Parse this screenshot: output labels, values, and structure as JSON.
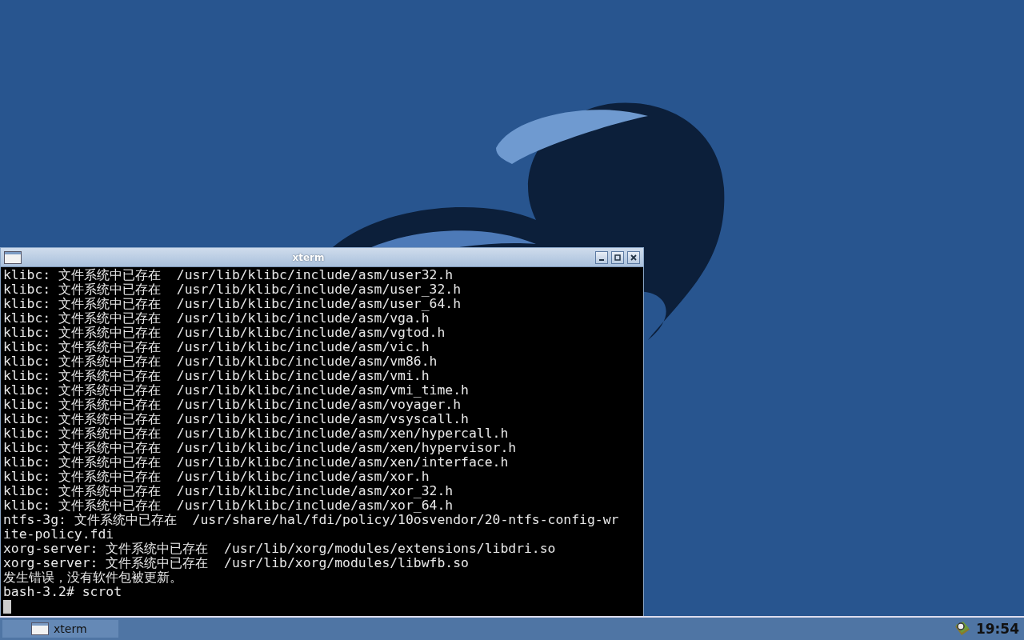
{
  "window": {
    "title": "xterm",
    "lines": [
      "klibc: 文件系统中已存在  /usr/lib/klibc/include/asm/user32.h",
      "klibc: 文件系统中已存在  /usr/lib/klibc/include/asm/user_32.h",
      "klibc: 文件系统中已存在  /usr/lib/klibc/include/asm/user_64.h",
      "klibc: 文件系统中已存在  /usr/lib/klibc/include/asm/vga.h",
      "klibc: 文件系统中已存在  /usr/lib/klibc/include/asm/vgtod.h",
      "klibc: 文件系统中已存在  /usr/lib/klibc/include/asm/vic.h",
      "klibc: 文件系统中已存在  /usr/lib/klibc/include/asm/vm86.h",
      "klibc: 文件系统中已存在  /usr/lib/klibc/include/asm/vmi.h",
      "klibc: 文件系统中已存在  /usr/lib/klibc/include/asm/vmi_time.h",
      "klibc: 文件系统中已存在  /usr/lib/klibc/include/asm/voyager.h",
      "klibc: 文件系统中已存在  /usr/lib/klibc/include/asm/vsyscall.h",
      "klibc: 文件系统中已存在  /usr/lib/klibc/include/asm/xen/hypercall.h",
      "klibc: 文件系统中已存在  /usr/lib/klibc/include/asm/xen/hypervisor.h",
      "klibc: 文件系统中已存在  /usr/lib/klibc/include/asm/xen/interface.h",
      "klibc: 文件系统中已存在  /usr/lib/klibc/include/asm/xor.h",
      "klibc: 文件系统中已存在  /usr/lib/klibc/include/asm/xor_32.h",
      "klibc: 文件系统中已存在  /usr/lib/klibc/include/asm/xor_64.h",
      "ntfs-3g: 文件系统中已存在  /usr/share/hal/fdi/policy/10osvendor/20-ntfs-config-wr",
      "ite-policy.fdi",
      "xorg-server: 文件系统中已存在  /usr/lib/xorg/modules/extensions/libdri.so",
      "xorg-server: 文件系统中已存在  /usr/lib/xorg/modules/libwfb.so",
      "发生错误，没有软件包被更新。",
      "bash-3.2# scrot"
    ]
  },
  "taskbar": {
    "tasks": [
      {
        "label": "xterm",
        "selected": true
      }
    ],
    "clock": "19:54"
  }
}
